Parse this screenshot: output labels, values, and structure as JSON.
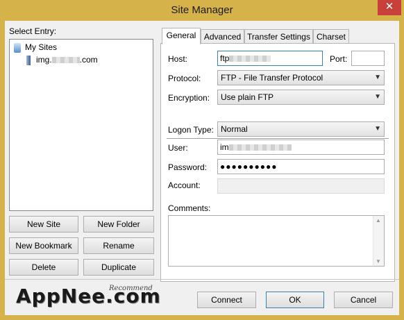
{
  "window": {
    "title": "Site Manager"
  },
  "left": {
    "select_entry_label": "Select Entry:",
    "tree": {
      "root_label": "My Sites",
      "site_label_prefix": "img.",
      "site_label_suffix": ".com"
    },
    "buttons": {
      "new_site": "New Site",
      "new_folder": "New Folder",
      "new_bookmark": "New Bookmark",
      "rename": "Rename",
      "delete": "Delete",
      "duplicate": "Duplicate"
    }
  },
  "tabs": [
    "General",
    "Advanced",
    "Transfer Settings",
    "Charset"
  ],
  "general": {
    "host_label": "Host:",
    "host_value": "ftp",
    "port_label": "Port:",
    "port_value": "",
    "protocol_label": "Protocol:",
    "protocol_value": "FTP - File Transfer Protocol",
    "encryption_label": "Encryption:",
    "encryption_value": "Use plain FTP",
    "logon_type_label": "Logon Type:",
    "logon_type_value": "Normal",
    "user_label": "User:",
    "user_value": "im",
    "password_label": "Password:",
    "password_value": "●●●●●●●●●●",
    "account_label": "Account:",
    "account_value": "",
    "comments_label": "Comments:"
  },
  "footer": {
    "logo": "AppNee.com",
    "logo_sup": "Recommend",
    "connect": "Connect",
    "ok": "OK",
    "cancel": "Cancel"
  }
}
